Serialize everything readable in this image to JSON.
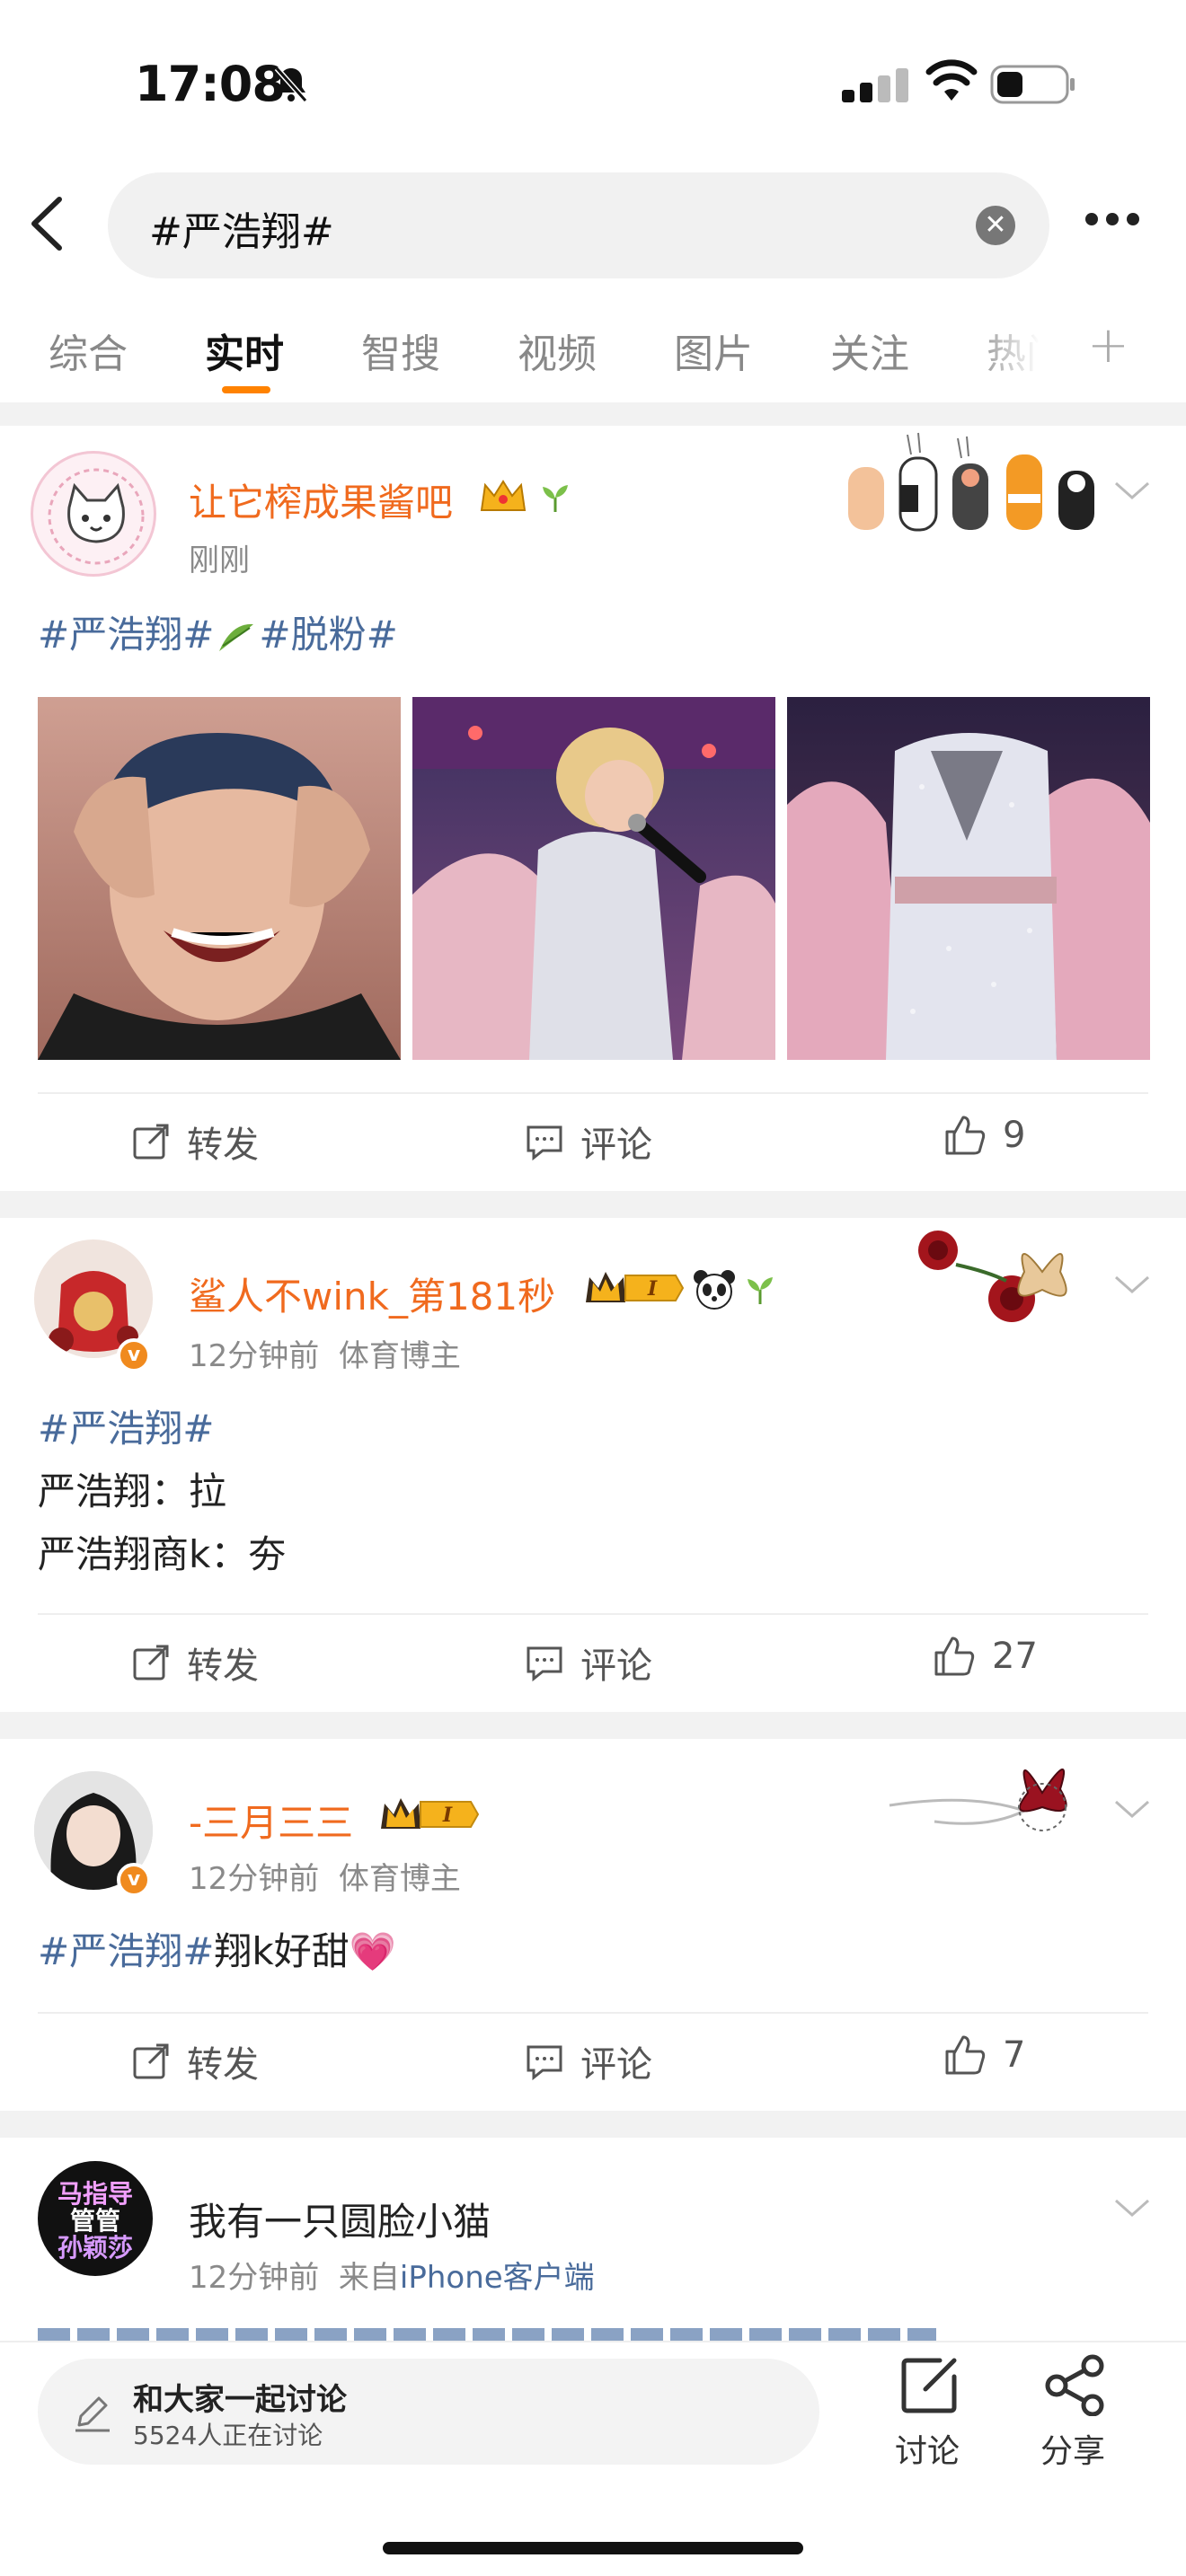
{
  "status_bar": {
    "time": "17:08"
  },
  "search": {
    "query": "#严浩翔#"
  },
  "tabs": [
    "综合",
    "实时",
    "智搜",
    "视频",
    "图片",
    "关注",
    "热门"
  ],
  "active_tab": "实时",
  "posts": [
    {
      "username": "让它榨成果酱吧",
      "time": "刚刚",
      "tag1": "#严浩翔#",
      "tag2": "#脱粉#",
      "repost": "转发",
      "comment": "评论",
      "likes": "9"
    },
    {
      "username": "鲨人不wink_第181秒",
      "time": "12分钟前",
      "badge_text": "体育博主",
      "tag": "#严浩翔#",
      "line1": "严浩翔：拉",
      "line2": "严浩翔商k：夯",
      "repost": "转发",
      "comment": "评论",
      "likes": "27"
    },
    {
      "username": "-三月三三",
      "time": "12分钟前",
      "badge_text": "体育博主",
      "tag": "#严浩翔#",
      "text": "翔k好甜💗",
      "repost": "转发",
      "comment": "评论",
      "likes": "7"
    },
    {
      "username": "我有一只圆脸小猫",
      "time": "12分钟前",
      "source_prefix": "来自",
      "source": "iPhone客户端",
      "avatar_text": [
        "马指导",
        "管管",
        "孙颖莎"
      ]
    }
  ],
  "bottom_bar": {
    "discuss_title": "和大家一起讨论",
    "discuss_count": "5524人正在讨论",
    "discuss_label": "讨论",
    "share_label": "分享"
  },
  "colors": {
    "accent": "#ff8200",
    "username": "#f06a1e",
    "hashtag": "#496b9b"
  }
}
